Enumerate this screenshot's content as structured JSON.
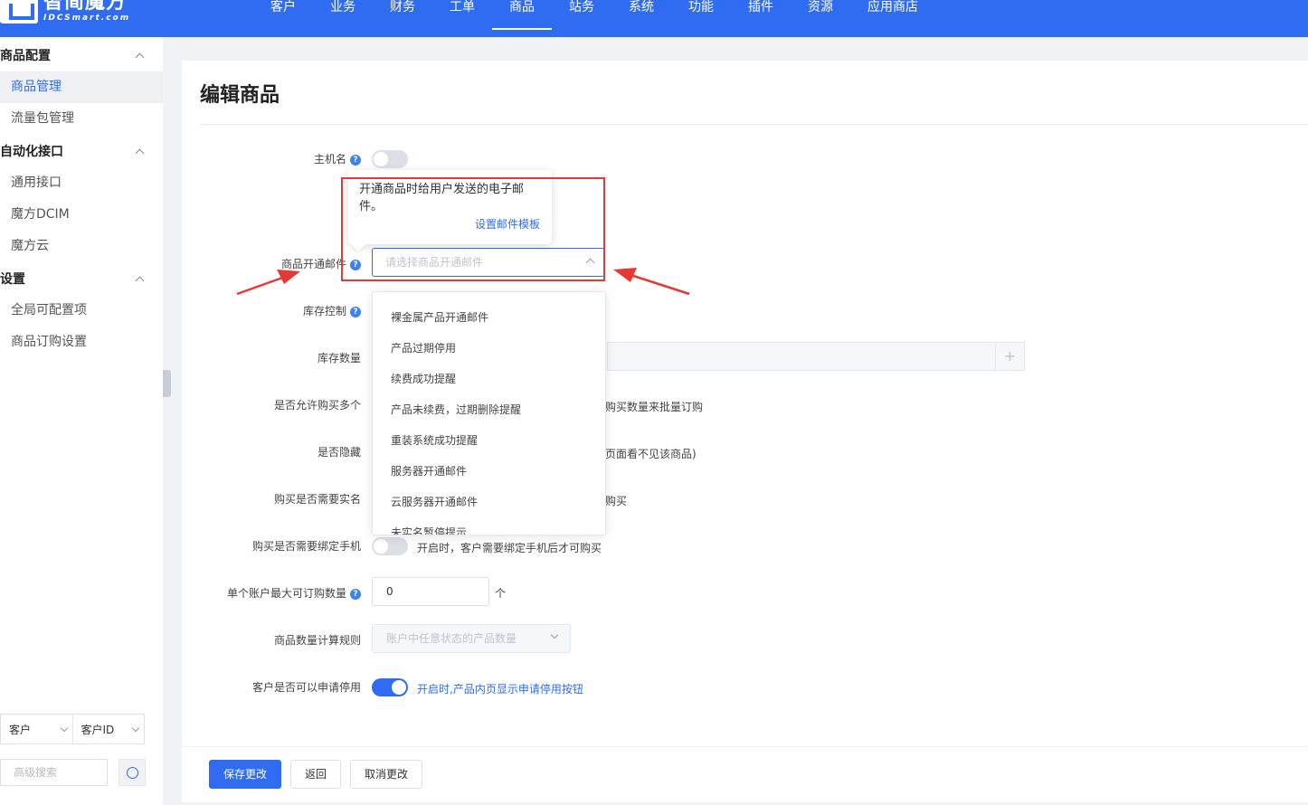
{
  "brand": {
    "name_cn": "智简魔方",
    "name_en": "IDCSmart.com"
  },
  "nav": [
    "客户",
    "业务",
    "财务",
    "工单",
    "商品",
    "站务",
    "系统",
    "功能",
    "插件",
    "资源",
    "应用商店"
  ],
  "sidebar": {
    "groups": [
      {
        "title": "商品配置",
        "items": [
          "商品管理",
          "流量包管理"
        ]
      },
      {
        "title": "自动化接口",
        "items": [
          "通用接口",
          "魔方DCIM",
          "魔方云"
        ]
      },
      {
        "title": "设置",
        "items": [
          "全局可配置项",
          "商品订购设置"
        ]
      }
    ],
    "search": {
      "field1": "客户",
      "field2": "客户ID",
      "placeholder": "高级搜索"
    }
  },
  "page": {
    "title": "编辑商品"
  },
  "form": {
    "hostname_label": "主机名",
    "mail_label": "商品开通邮件",
    "mail_placeholder": "请选择商品开通邮件",
    "stock_control_label": "库存控制",
    "stock_qty_label": "库存数量",
    "stock_plus": "+",
    "allow_multi_label": "是否允许购买多个",
    "allow_multi_hint": "购买数量来批量订购",
    "hidden_label": "是否隐藏",
    "hidden_hint": "页面看不见该商品)",
    "realname_label": "购买是否需要实名",
    "realname_hint": "购买",
    "phone_label": "购买是否需要绑定手机",
    "phone_hint": "开启时，客户需要绑定手机后才可购买",
    "max_order_label": "单个账户最大可订购数量",
    "max_order_value": "0",
    "max_order_unit": "个",
    "count_rule_label": "商品数量计算规则",
    "count_rule_placeholder": "账户中任意状态的产品数量",
    "suspend_label": "客户是否可以申请停用",
    "suspend_hint": "开启时,产品内页显示申请停用按钮"
  },
  "tooltip": {
    "text": "开通商品时给用户发送的电子邮件。",
    "link": "设置邮件模板"
  },
  "dropdown_options": [
    "裸金属产品开通邮件",
    "产品过期停用",
    "续费成功提醒",
    "产品未续费，过期删除提醒",
    "重装系统成功提醒",
    "服务器开通邮件",
    "云服务器开通邮件",
    "未实名暂停提示"
  ],
  "buttons": {
    "save": "保存更改",
    "back": "返回",
    "cancel": "取消更改"
  },
  "colors": {
    "primary": "#2f6cf1",
    "annotation": "#e53935"
  }
}
